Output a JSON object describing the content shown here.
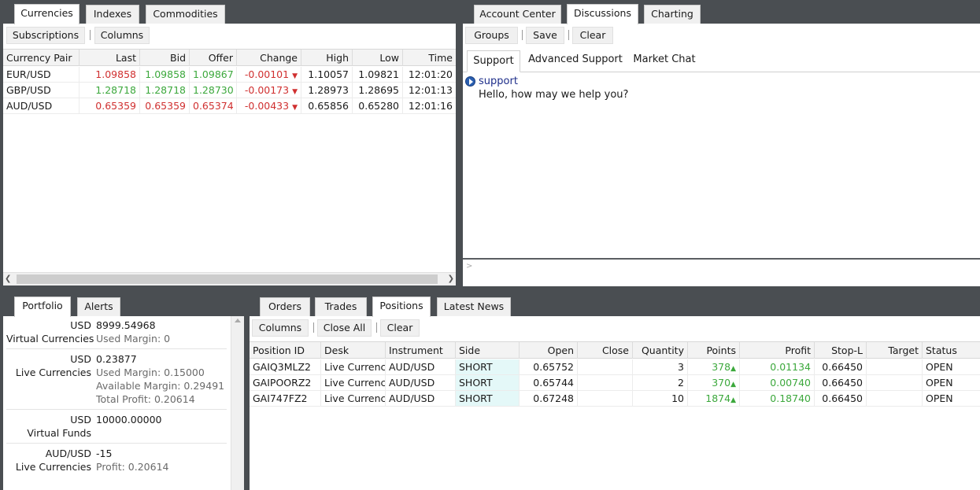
{
  "top_left": {
    "tabs": [
      "Currencies",
      "Indexes",
      "Commodities"
    ],
    "toolbar": {
      "subscriptions": "Subscriptions",
      "columns": "Columns"
    },
    "columns": [
      "Currency Pair",
      "Last",
      "Bid",
      "Offer",
      "Change",
      "High",
      "Low",
      "Time"
    ],
    "rows": [
      {
        "pair": "EUR/USD",
        "last": "1.09858",
        "bid": "1.09858",
        "offer": "1.09867",
        "change": "-0.00101",
        "high": "1.10057",
        "low": "1.09821",
        "time": "12:01:20"
      },
      {
        "pair": "GBP/USD",
        "last": "1.28718",
        "bid": "1.28718",
        "offer": "1.28730",
        "change": "-0.00173",
        "high": "1.28973",
        "low": "1.28695",
        "time": "12:01:13"
      },
      {
        "pair": "AUD/USD",
        "last": "0.65359",
        "bid": "0.65359",
        "offer": "0.65374",
        "change": "-0.00433",
        "high": "0.65856",
        "low": "0.65280",
        "time": "12:01:16"
      }
    ],
    "arrow": "▼"
  },
  "top_right": {
    "tabs": [
      "Account Center",
      "Discussions",
      "Charting"
    ],
    "toolbar": {
      "groups": "Groups",
      "save": "Save",
      "clear": "Clear"
    },
    "subtabs": [
      "Support",
      "Advanced Support",
      "Market Chat"
    ],
    "message": {
      "sender": "support",
      "text": "Hello, how may we help you?"
    },
    "input_prompt": ">"
  },
  "bottom_left": {
    "tabs": [
      "Portfolio",
      "Alerts"
    ],
    "blocks": [
      {
        "currency": "USD",
        "value": "8999.54968",
        "label": "Virtual Currencies",
        "details": [
          "Used Margin:  0"
        ]
      },
      {
        "currency": "USD",
        "value": "0.23877",
        "label": "Live Currencies",
        "details": [
          "Used Margin:  0.15000",
          "Available Margin:  0.29491",
          "Total Profit:  0.20614"
        ]
      },
      {
        "currency": "USD",
        "value": "10000.00000",
        "label": "Virtual Funds",
        "details": []
      },
      {
        "currency": "AUD/USD",
        "value": "-15",
        "label": "Live Currencies",
        "details": [
          "Profit:  0.20614"
        ]
      }
    ]
  },
  "bottom_right": {
    "tabs": [
      "Orders",
      "Trades",
      "Positions",
      "Latest News"
    ],
    "toolbar": {
      "columns": "Columns",
      "close_all": "Close All",
      "clear": "Clear"
    },
    "columns": [
      "Position ID",
      "Desk",
      "Instrument",
      "Side",
      "Open",
      "Close",
      "Quantity",
      "Points",
      "Profit",
      "Stop-L",
      "Target",
      "Status"
    ],
    "rows": [
      {
        "id": "GAIQ3MLZ2",
        "desk": "Live Currencies",
        "instrument": "AUD/USD",
        "side": "SHORT",
        "open": "0.65752",
        "close": "",
        "quantity": "3",
        "points": "378",
        "profit": "0.01134",
        "stop": "0.66450",
        "target": "",
        "status": "OPEN"
      },
      {
        "id": "GAIPOORZ2",
        "desk": "Live Currencies",
        "instrument": "AUD/USD",
        "side": "SHORT",
        "open": "0.65744",
        "close": "",
        "quantity": "2",
        "points": "370",
        "profit": "0.00740",
        "stop": "0.66450",
        "target": "",
        "status": "OPEN"
      },
      {
        "id": "GAI747FZ2",
        "desk": "Live Currencies",
        "instrument": "AUD/USD",
        "side": "SHORT",
        "open": "0.67248",
        "close": "",
        "quantity": "10",
        "points": "1874",
        "profit": "0.18740",
        "stop": "0.66450",
        "target": "",
        "status": "OPEN"
      }
    ],
    "arrow": "▲"
  }
}
